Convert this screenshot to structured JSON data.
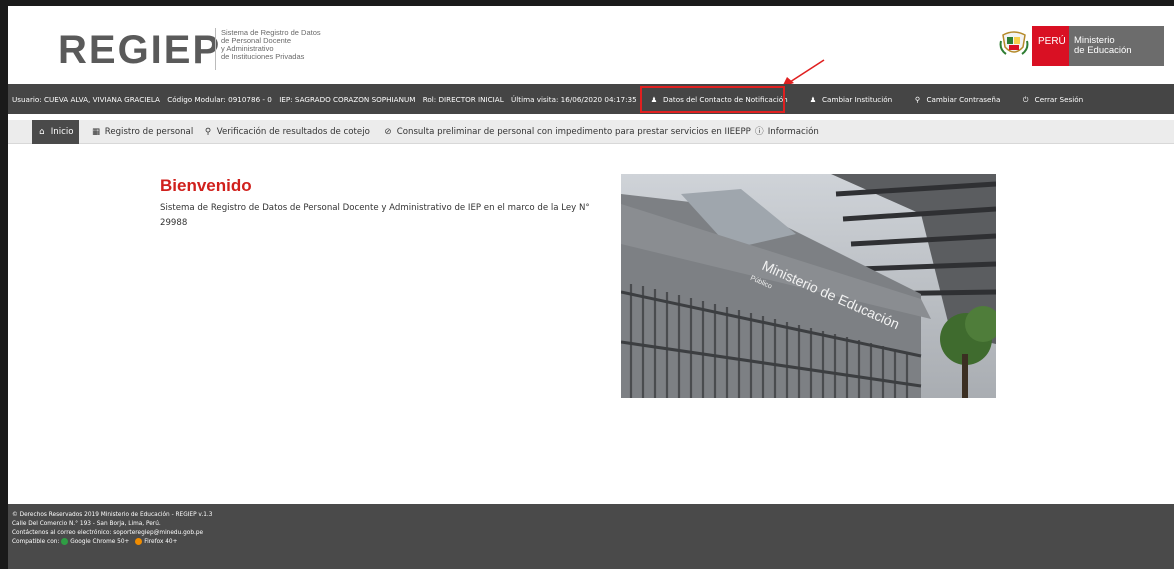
{
  "header": {
    "logo_text": "REGIEP",
    "tagline": [
      "Sistema de Registro de Datos",
      "de Personal Docente",
      "y Administrativo",
      "de Instituciones Privadas"
    ],
    "peru_label": "PERÚ",
    "ministry_label": [
      "Ministerio",
      "de Educación"
    ]
  },
  "topbar": {
    "usuario": "Usuario: CUEVA ALVA, VIVIANA GRACIELA",
    "codigo": "Código Modular: 0910786 - 0",
    "iep": "IEP: SAGRADO CORAZON SOPHIANUM",
    "rol": "Rol: DIRECTOR INICIAL",
    "visita": "Última visita: 16/06/2020 04:17:35",
    "links": {
      "contacto": "Datos del Contacto de Notificación",
      "institucion": "Cambiar Institución",
      "contrasena": "Cambiar Contraseña",
      "cerrar": "Cerrar Sesión"
    }
  },
  "nav": {
    "inicio": "Inicio",
    "registro": "Registro de personal",
    "verificacion": "Verificación de resultados de cotejo",
    "consulta": "Consulta preliminar de personal con impedimento para prestar servicios en IIEEPP",
    "informacion": "Información"
  },
  "main": {
    "title": "Bienvenido",
    "description": "Sistema de Registro de Datos de Personal Docente y Administrativo de IEP en el marco de la Ley N° 29988",
    "photo_sign": "Ministerio de Educación",
    "photo_sign_small": "Público"
  },
  "footer": {
    "copyright": "© Derechos Reservados 2019 Ministerio de Educación - REGIEP v.1.3",
    "address": "Calle Del Comercio N.° 193 - San Borja, Lima, Perú.",
    "contact": "Contáctenos al correo electrónico: soporteregiep@minedu.gob.pe",
    "compatible_label": "Compatible con:",
    "chrome": "Google Chrome 50+",
    "firefox": "Firefox 40+"
  },
  "colors": {
    "accent_red": "#d0201c",
    "bar_dark": "#454545",
    "peru_red": "#d91023"
  }
}
